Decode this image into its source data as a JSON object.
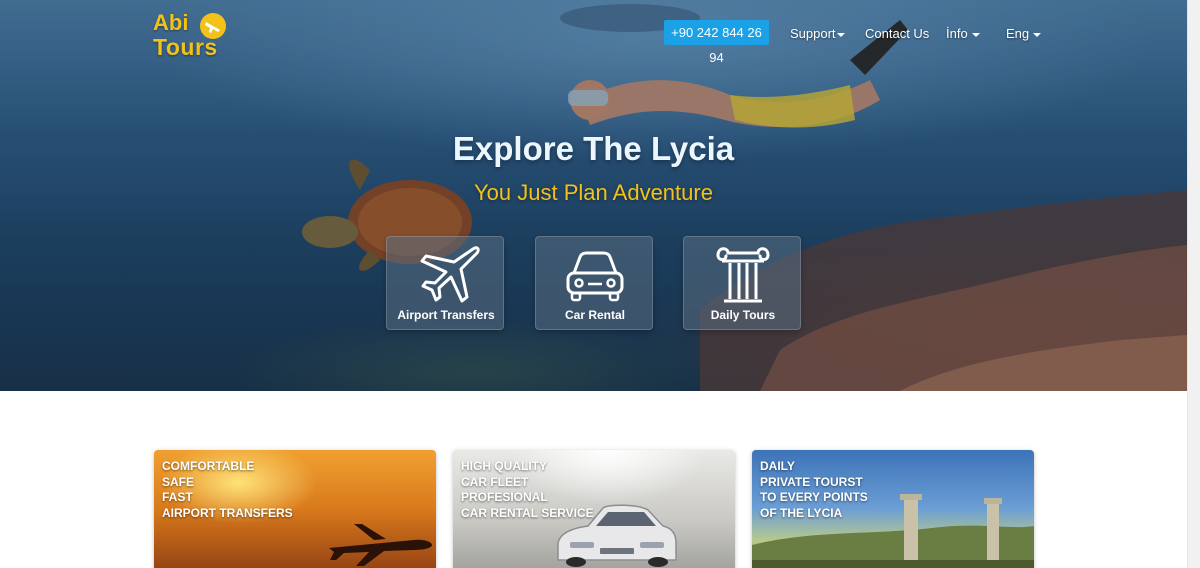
{
  "brand": {
    "logo_line1": "Abi",
    "logo_line2": "Tours",
    "brand_color": "#f2c21b"
  },
  "nav": {
    "phone": "+90 242 844 26 94",
    "support": "Support",
    "contact": "Contact Us",
    "info": "İnfo",
    "lang": "Eng",
    "accent_color": "#1aa1e6"
  },
  "hero": {
    "title": "Explore The Lycia",
    "subtitle": "You Just Plan Adventure"
  },
  "services": [
    {
      "label": "Airport Transfers",
      "icon": "airplane-icon"
    },
    {
      "label": "Car Rental",
      "icon": "car-icon"
    },
    {
      "label": "Daily Tours",
      "icon": "column-icon"
    }
  ],
  "cards": [
    {
      "lines": [
        "COMFORTABLE",
        "SAFE",
        "FAST",
        "AIRPORT TRANSFERS"
      ]
    },
    {
      "lines": [
        "HIGH QUALITY",
        "CAR FLEET",
        "PROFESIONAL",
        "CAR RENTAL SERVICE"
      ]
    },
    {
      "lines": [
        "DAILY",
        "PRIVATE TOURST",
        "TO EVERY POINTS",
        "OF THE LYCIA"
      ]
    }
  ]
}
